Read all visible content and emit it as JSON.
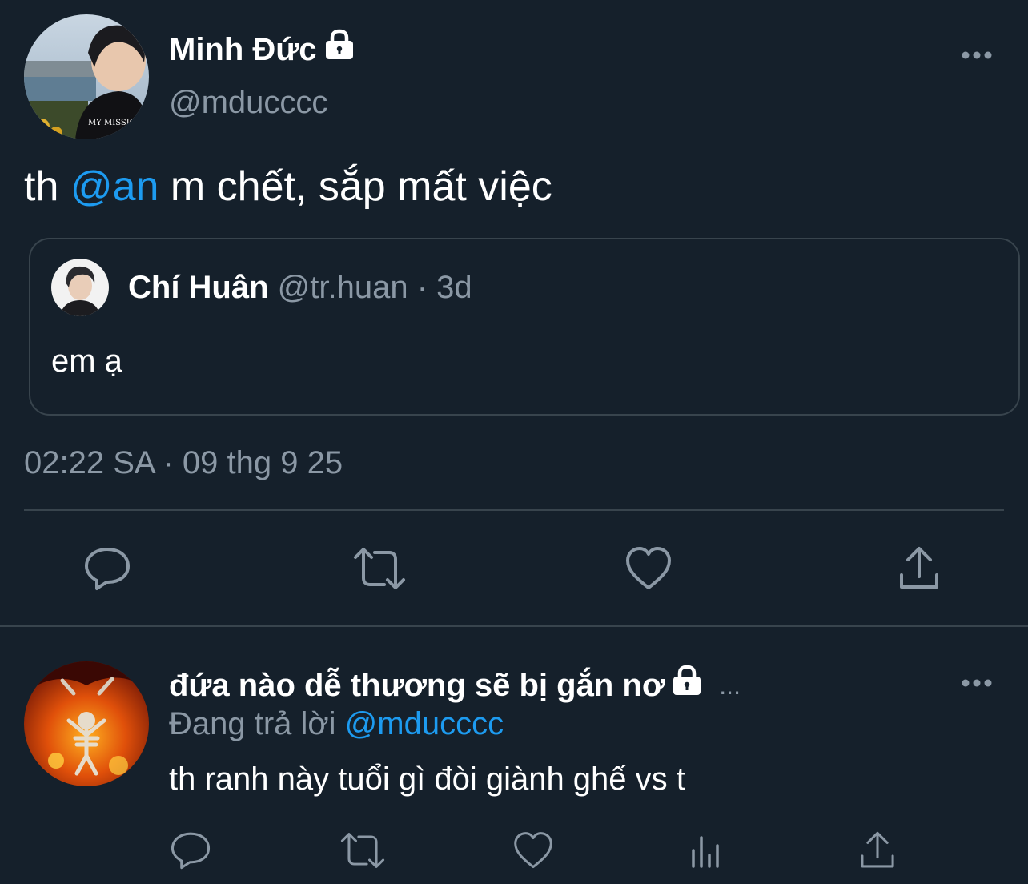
{
  "tweet": {
    "author": {
      "name": "Minh Đức",
      "handle": "@mducccc",
      "protected": true,
      "avatar": "profile-photo"
    },
    "text": {
      "before": "th ",
      "mention": "@an",
      "after": " m chết, sắp mất việc"
    },
    "quote": {
      "name": "Chí Huân",
      "meta": " @tr.huan · 3d",
      "text": "em ạ",
      "avatar": "profile-photo"
    },
    "timestamp": "02:22 SA · 09 thg 9 25",
    "actions": [
      "reply-icon",
      "retweet-icon",
      "like-icon",
      "share-icon"
    ]
  },
  "reply": {
    "author": {
      "name": "đứa nào dễ thương sẽ bị gắn nơ",
      "protected": true,
      "truncated": "...",
      "avatar": "profile-photo"
    },
    "replying_label": "Đang trả lời ",
    "replying_handle": "@mducccc",
    "text": "th ranh này tuổi gì đòi giành ghế vs t",
    "actions": [
      "reply-icon",
      "retweet-icon",
      "like-icon",
      "analytics-icon",
      "share-icon"
    ]
  },
  "colors": {
    "background": "#15202b",
    "accent": "#1d9bf0",
    "muted": "#8b98a5",
    "border": "#38444d"
  }
}
